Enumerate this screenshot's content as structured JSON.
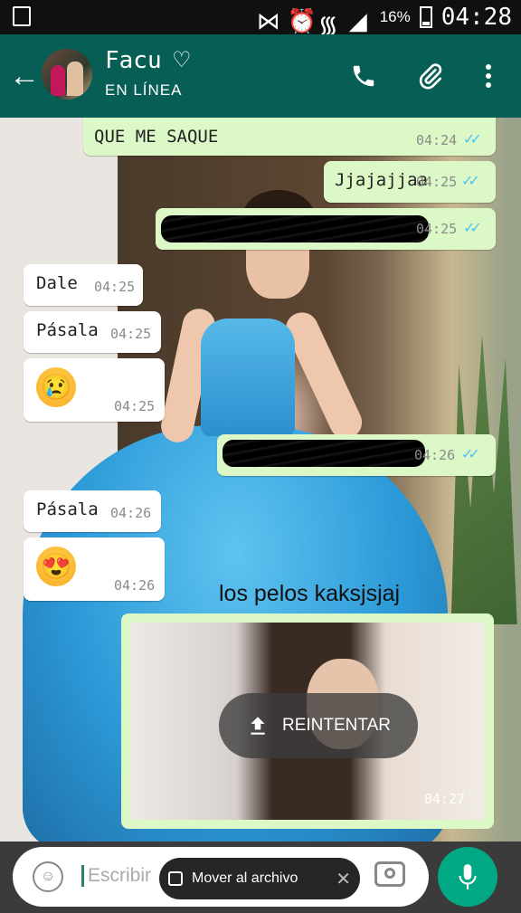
{
  "status_bar": {
    "battery_percent": "16%",
    "time": "04:28"
  },
  "header": {
    "contact_name": "Facu",
    "heart": "♡",
    "status": "EN LÍNEA",
    "back_icon": "←"
  },
  "messages": [
    {
      "dir": "out",
      "text": "QUE ME SAQUE",
      "time": "04:24"
    },
    {
      "dir": "out",
      "text": "Jjajajjaa",
      "time": "04:25"
    },
    {
      "dir": "out",
      "text": "",
      "time": "04:25",
      "redacted": true
    },
    {
      "dir": "in",
      "text": "Dale",
      "time": "04:25"
    },
    {
      "dir": "in",
      "text": "Pásala",
      "time": "04:25"
    },
    {
      "dir": "in",
      "text": "😢",
      "time": "04:25"
    },
    {
      "dir": "out",
      "text": "",
      "time": "04:26",
      "redacted": true
    },
    {
      "dir": "in",
      "text": "Pásala",
      "time": "04:26"
    },
    {
      "dir": "in",
      "text": "😍",
      "time": "04:26"
    }
  ],
  "media": {
    "caption": "los pelos kaksjsjaj",
    "retry_label": "REINTENTAR",
    "time": "04:27"
  },
  "input": {
    "placeholder": "Escribir"
  },
  "snackbar": {
    "label": "Mover al archivo",
    "close": "✕"
  },
  "colors": {
    "header": "#075e54",
    "outgoing_bubble": "#dcf8c6",
    "incoming_bubble": "#ffffff",
    "ticks": "#4fc3f7",
    "mic": "#00a884"
  }
}
